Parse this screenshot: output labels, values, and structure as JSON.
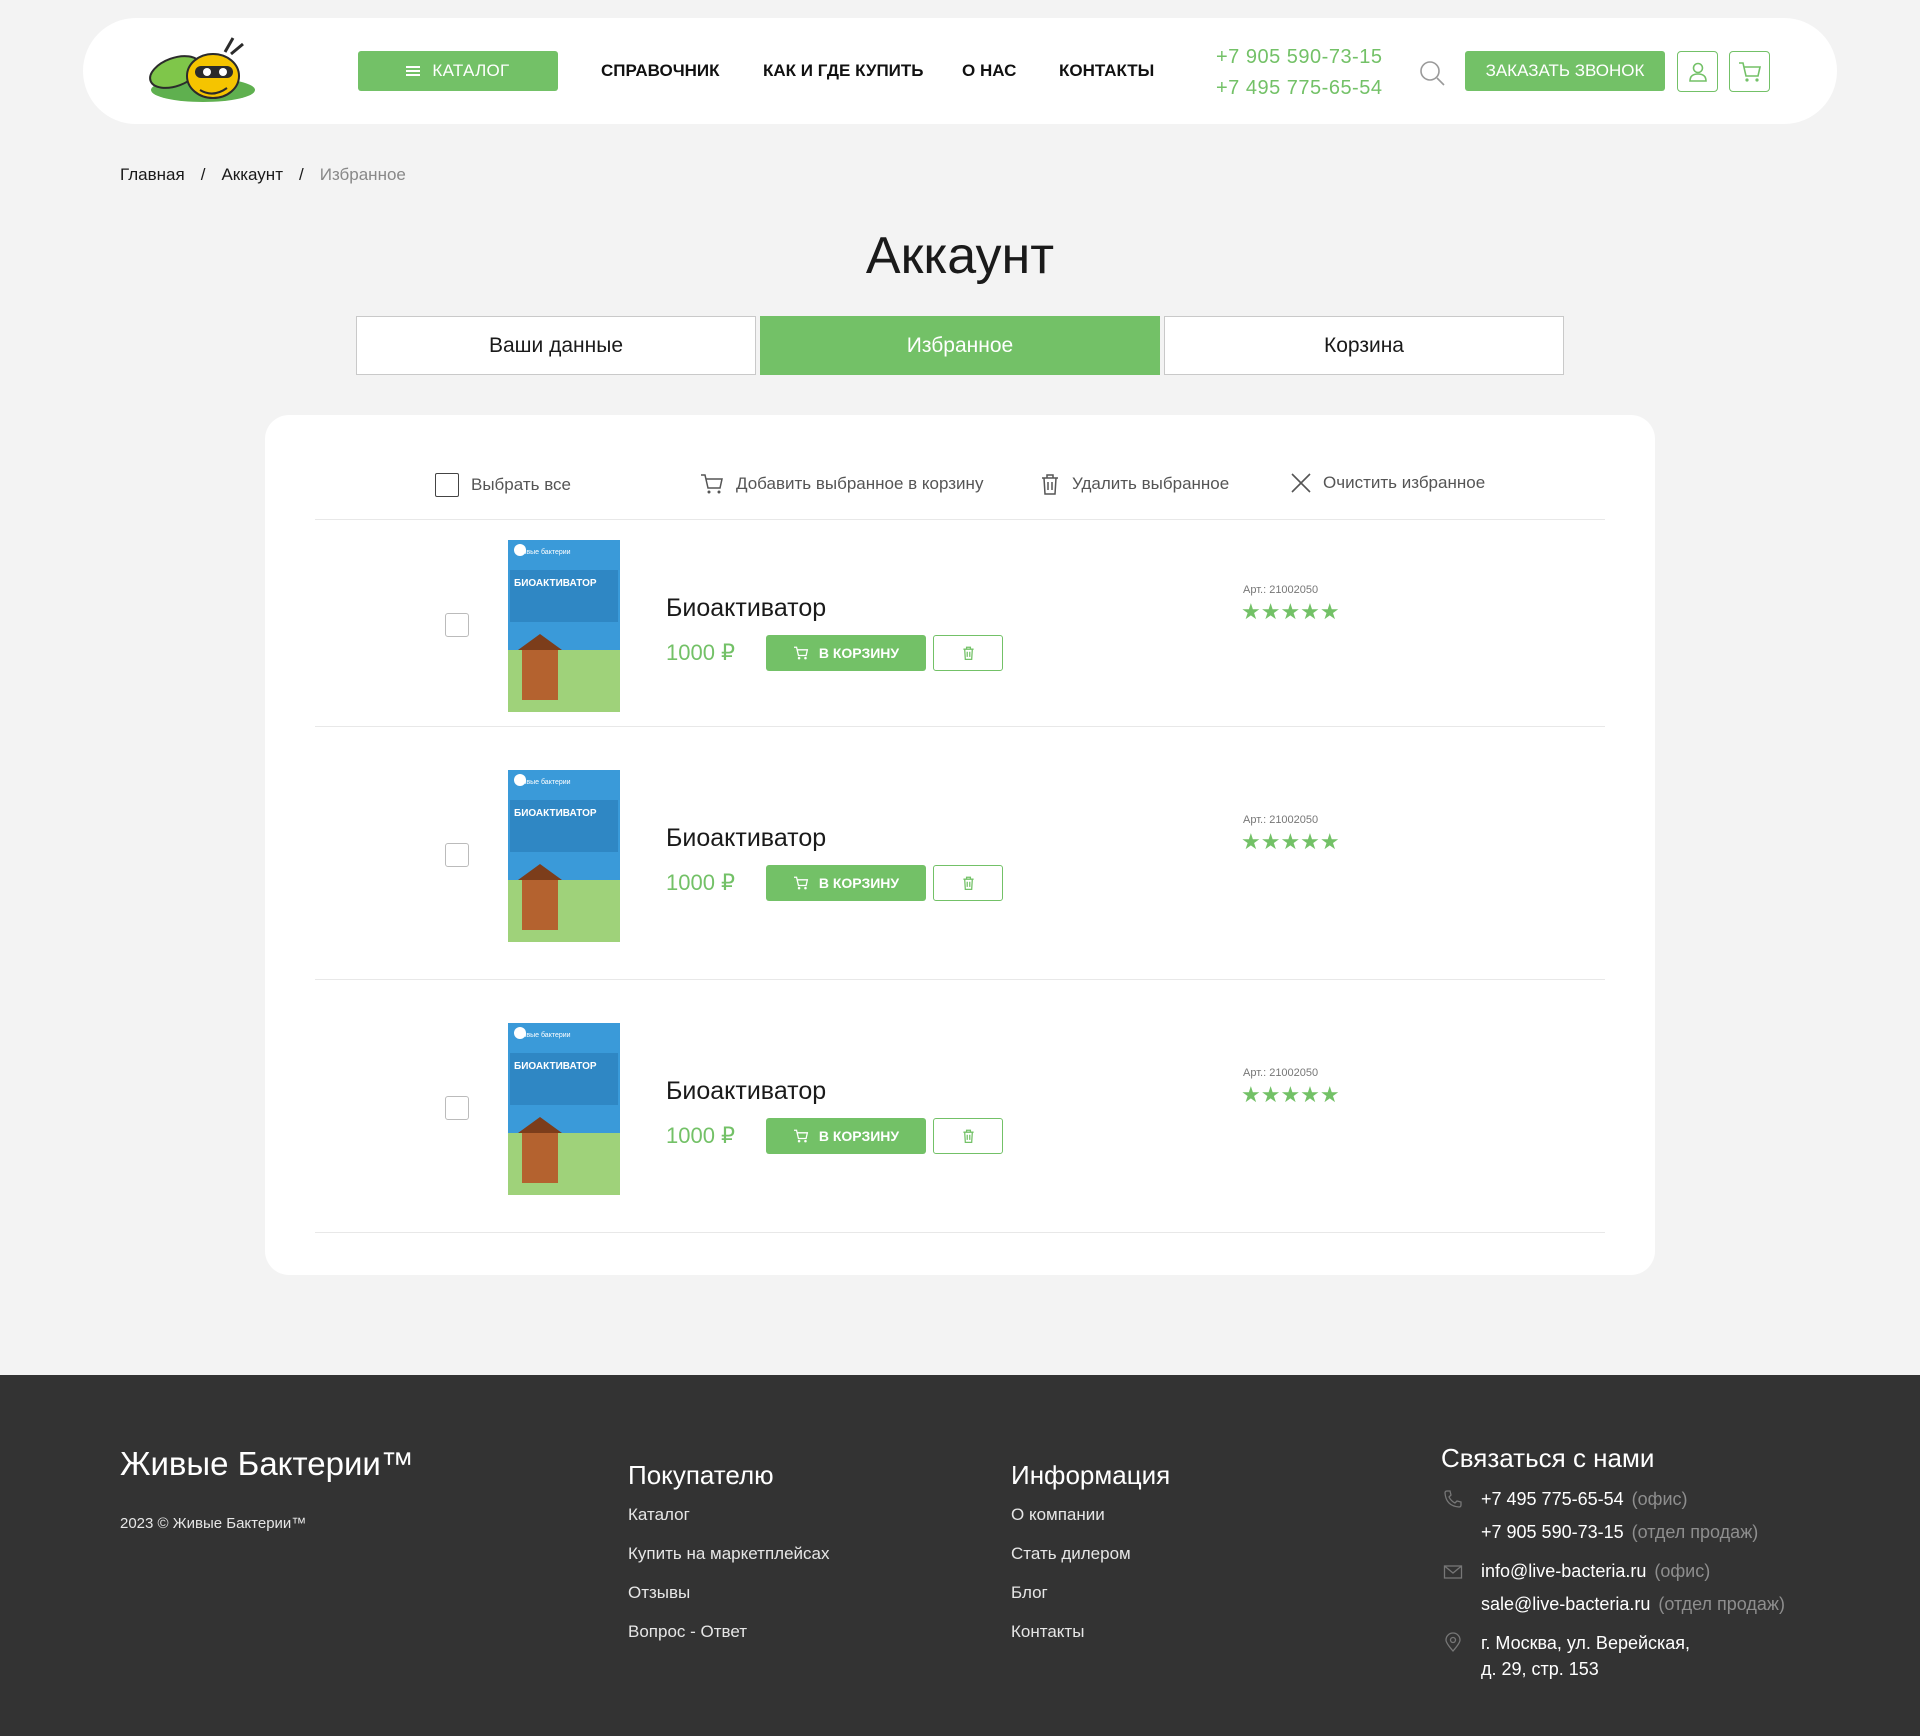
{
  "header": {
    "catalog_label": "КАТАЛОГ",
    "nav": [
      "СПРАВОЧНИК",
      "КАК И ГДЕ КУПИТЬ",
      "О НАС",
      "КОНТАКТЫ"
    ],
    "phone_1": "+7 905 590-73-15",
    "phone_2": "+7 495 775-65-54",
    "call_label": "ЗАКАЗАТЬ ЗВОНОК"
  },
  "breadcrumb": {
    "home": "Главная",
    "sep": "/",
    "account": "Аккаунт",
    "current": "Избранное"
  },
  "page_title": "Аккаунт",
  "tabs": [
    {
      "label": "Ваши данные",
      "active": false
    },
    {
      "label": "Избранное",
      "active": true
    },
    {
      "label": "Корзина",
      "active": false
    }
  ],
  "toolbar": {
    "select_all": "Выбрать все",
    "add_selected": "Добавить выбранное в корзину",
    "delete_selected": "Удалить выбранное",
    "clear": "Очистить избранное"
  },
  "items": [
    {
      "name": "Биоактиватор",
      "price": "1000 ₽",
      "cart_label": "В КОРЗИНУ",
      "art": "Арт.: 21002050",
      "stars": "★★★★★",
      "rating": 5,
      "checked": false
    },
    {
      "name": "Биоактиватор",
      "price": "1000 ₽",
      "cart_label": "В КОРЗИНУ",
      "art": "Арт.: 21002050",
      "stars": "★★★★★",
      "rating": 5,
      "checked": false
    },
    {
      "name": "Биоактиватор",
      "price": "1000 ₽",
      "cart_label": "В КОРЗИНУ",
      "art": "Арт.: 21002050",
      "stars": "★★★★★",
      "rating": 5,
      "checked": false
    }
  ],
  "product_image": {
    "brand": "Живые бактерии",
    "title": "БИОАКТИВАТОР"
  },
  "footer": {
    "brand": "Живые Бактерии™",
    "copyright": "2023 © Живые Бактерии™",
    "buyer_title": "Покупателю",
    "buyer_links": [
      "Каталог",
      "Купить на маркетплейсах",
      "Отзывы",
      "Вопрос - Ответ"
    ],
    "info_title": "Информация",
    "info_links": [
      "О компании",
      "Стать дилером",
      "Блог",
      "Контакты"
    ],
    "contact_title": "Связаться с нами",
    "phone_office": "+7 495 775-65-54",
    "phone_office_note": "(офис)",
    "phone_sales": "+7 905 590-73-15",
    "phone_sales_note": "(отдел продаж)",
    "email_office": "info@live-bacteria.ru",
    "email_office_note": "(офис)",
    "email_sales": "sale@live-bacteria.ru",
    "email_sales_note": "(отдел продаж)",
    "address_1": "г. Москва, ул. Верейская,",
    "address_2": "д. 29, стр. 153"
  },
  "colors": {
    "accent": "#73c167",
    "background": "#f3f3f3",
    "footer": "#333333"
  },
  "icons": [
    "menu-icon",
    "search-icon",
    "user-icon",
    "cart-icon",
    "trash-icon",
    "close-icon",
    "phone-icon",
    "mail-icon",
    "location-icon",
    "star-icon"
  ]
}
